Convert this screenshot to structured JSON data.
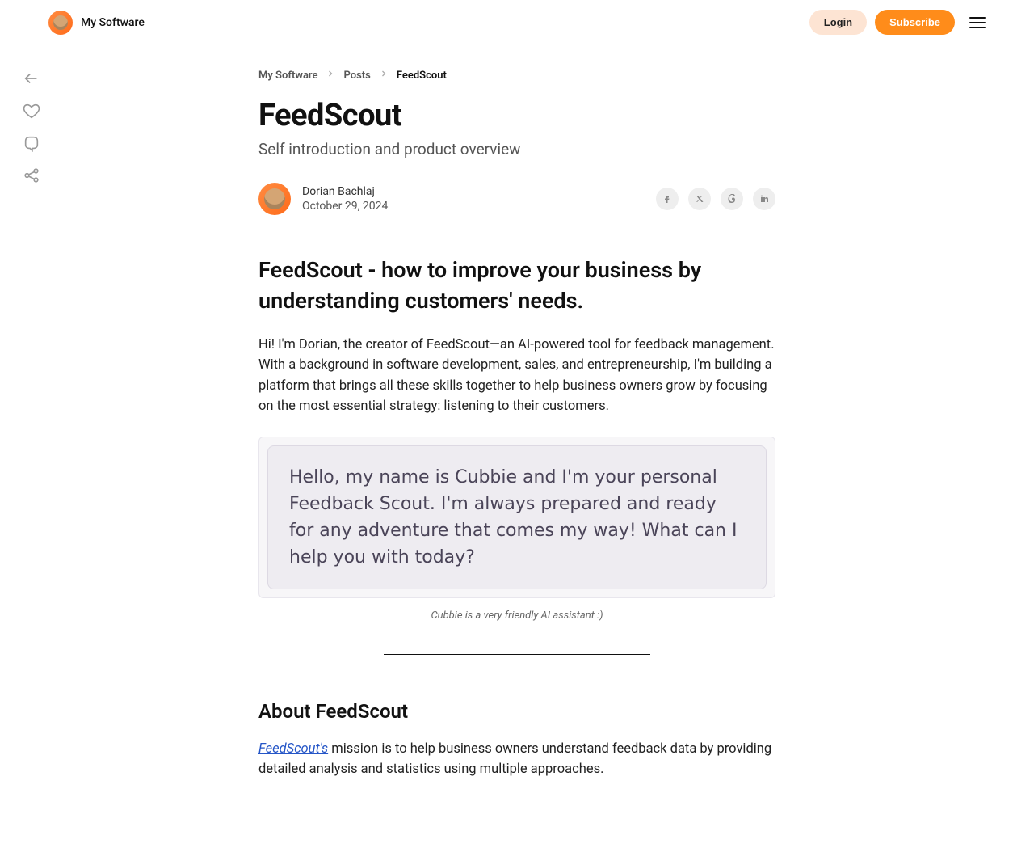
{
  "header": {
    "site_name": "My Software",
    "login_label": "Login",
    "subscribe_label": "Subscribe"
  },
  "breadcrumb": {
    "item0": "My Software",
    "item1": "Posts",
    "item2": "FeedScout"
  },
  "article": {
    "title": "FeedScout",
    "subtitle": "Self introduction and product overview",
    "author_name": "Dorian Bachlaj",
    "date": "October 29, 2024",
    "heading1": "FeedScout - how to improve your business by understanding customers' needs.",
    "paragraph1": "Hi! I'm Dorian, the creator of FeedScout—an AI-powered tool for feedback management. With a background in software development, sales, and entrepreneurship, I'm building a platform that brings all these skills together to help business owners grow by focusing on the most essential strategy: listening to their customers.",
    "chat_text": "Hello, my name is Cubbie and I'm your personal Feedback Scout. I'm always prepared and ready for any adventure that comes my way! What can I help you with today?",
    "caption": "Cubbie is a very friendly AI assistant :)",
    "heading2": "About FeedScout",
    "link_text": "FeedScout's",
    "paragraph2_rest": " mission is to help business owners understand feedback data by providing detailed analysis and statistics using multiple approaches."
  }
}
